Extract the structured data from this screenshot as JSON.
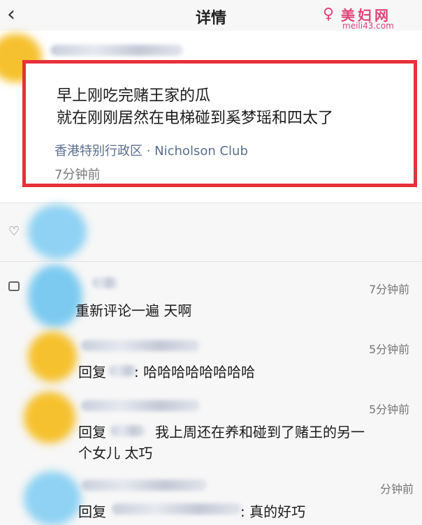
{
  "nav": {
    "back_icon": "chevron-left-icon",
    "title": "详情"
  },
  "watermark": {
    "logo_icon": "feminine-symbol-icon",
    "name": "美妇网",
    "url": "meili43.com"
  },
  "post": {
    "line1": "早上刚吃完赌王家的瓜",
    "line2": "就在刚刚居然在电梯碰到奚梦瑶和四太了",
    "location": "香港特别行政区 · Nicholson Club",
    "time": "7分钟前",
    "highlight_color": "#e8303a"
  },
  "comments": [
    {
      "time": "7分钟前",
      "text": "重新评论一遍 天啊"
    },
    {
      "time": "5分钟前",
      "reply_label": "回复",
      "text": ": 哈哈哈哈哈哈哈哈"
    },
    {
      "time": "5分钟前",
      "reply_label": "回复",
      "text": "我上周还在养和碰到了赌王的另一",
      "text2": "个女儿 太巧"
    },
    {
      "time": "分钟前",
      "reply_label": "回复",
      "text": ": 真的好巧"
    }
  ]
}
